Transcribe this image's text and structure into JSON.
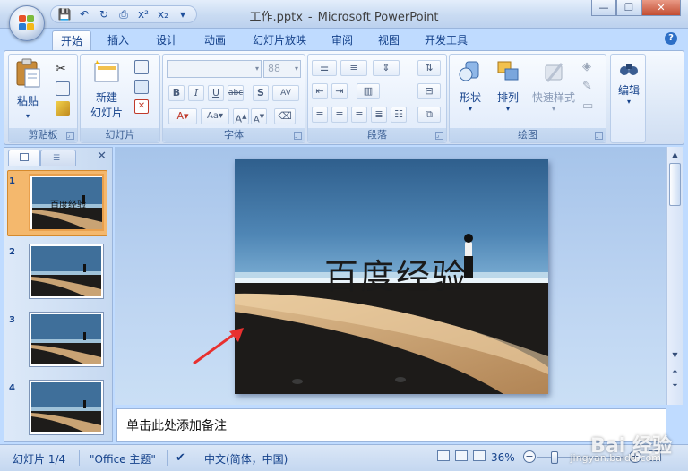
{
  "window": {
    "title_file": "工作.pptx",
    "title_dash": "-",
    "title_app": "Microsoft PowerPoint"
  },
  "qat": {
    "save": "💾",
    "undo": "↶",
    "redo": "↻",
    "print": "⎙",
    "sup": "x²",
    "sub": "x₂",
    "more": "▾"
  },
  "window_controls": {
    "minimize": "—",
    "restore": "❐",
    "close": "✕"
  },
  "tabs": [
    "开始",
    "插入",
    "设计",
    "动画",
    "幻灯片放映",
    "审阅",
    "视图",
    "开发工具"
  ],
  "active_tab": "开始",
  "ribbon": {
    "clipboard": {
      "paste": "粘贴",
      "label": "剪贴板"
    },
    "slides": {
      "new_slide_line1": "新建",
      "new_slide_line2": "幻灯片",
      "label": "幻灯片"
    },
    "font": {
      "font_size": "88",
      "label": "字体"
    },
    "paragraph": {
      "label": "段落"
    },
    "drawing": {
      "shape": "形状",
      "arrange": "排列",
      "quick_styles": "快速样式",
      "label": "绘图"
    },
    "editing": {
      "edit": "编辑"
    }
  },
  "slides_panel": {
    "thumbnails": [
      {
        "num": "1",
        "title": "百度经验"
      },
      {
        "num": "2"
      },
      {
        "num": "3"
      },
      {
        "num": "4"
      }
    ]
  },
  "slide": {
    "title": "百度经验"
  },
  "notes": {
    "placeholder": "单击此处添加备注"
  },
  "status": {
    "slide_info": "幻灯片 1/4",
    "theme": "\"Office 主题\"",
    "language": "中文(简体，中国)",
    "zoom": "36%"
  },
  "watermark": {
    "brand": "Bai 经验",
    "url": "jingyan.baidu.com"
  },
  "colors": {
    "ribbon_bg": "#dae6f6",
    "accent": "#15428b",
    "selection": "#f4b86d",
    "arrow": "#e8302f"
  }
}
